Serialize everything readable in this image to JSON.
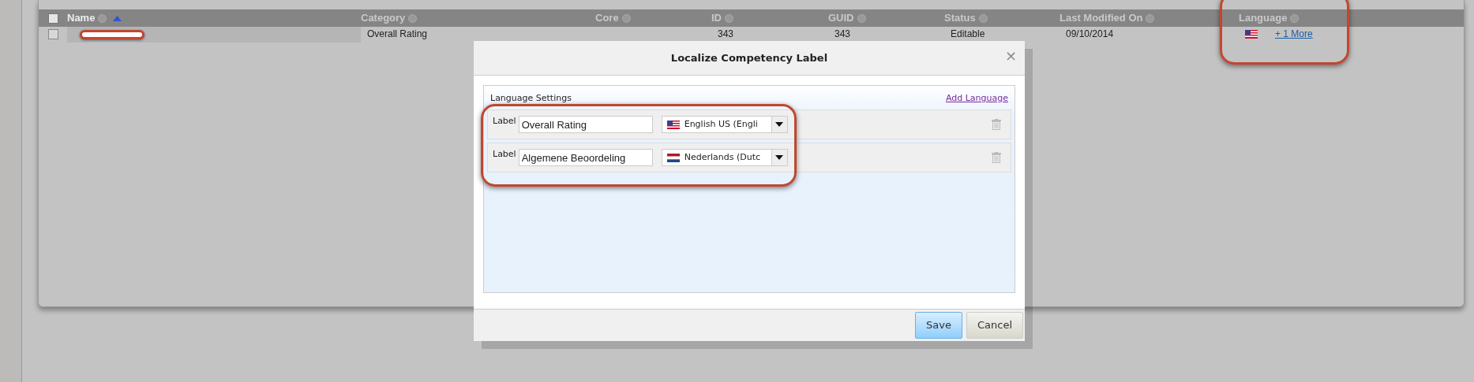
{
  "table": {
    "header_checked": false,
    "columns": [
      {
        "label": "Name",
        "sorted": true
      },
      {
        "label": "Category",
        "sorted": false
      },
      {
        "label": "Core",
        "sorted": false
      },
      {
        "label": "ID",
        "sorted": false
      },
      {
        "label": "GUID",
        "sorted": false
      },
      {
        "label": "Status",
        "sorted": false
      },
      {
        "label": "Last Modified On",
        "sorted": false
      },
      {
        "label": "Language",
        "sorted": false
      }
    ],
    "rows": [
      {
        "checked": false,
        "category": "Overall Rating",
        "id": "343",
        "guid": "343",
        "status": "Editable",
        "last_modified": "09/10/2014",
        "flag": {
          "kind": "us"
        },
        "language": "+ 1 More"
      }
    ]
  },
  "dialog": {
    "title": "Localize Competency Label",
    "close": "×",
    "section_title": "Language Settings",
    "add_link": "Add Language",
    "rows": [
      {
        "label": "Label",
        "value": "Overall Rating",
        "flag": {
          "kind": "us"
        },
        "language": "English US (Engli"
      },
      {
        "label": "Label",
        "value": "Algemene Beoordeling",
        "flag": {
          "kind": "nl"
        },
        "language": "Nederlands (Dutc"
      }
    ],
    "buttons": [
      {
        "label": "Save",
        "kind": "primary"
      },
      {
        "label": "Cancel",
        "kind": "secondary"
      }
    ]
  }
}
